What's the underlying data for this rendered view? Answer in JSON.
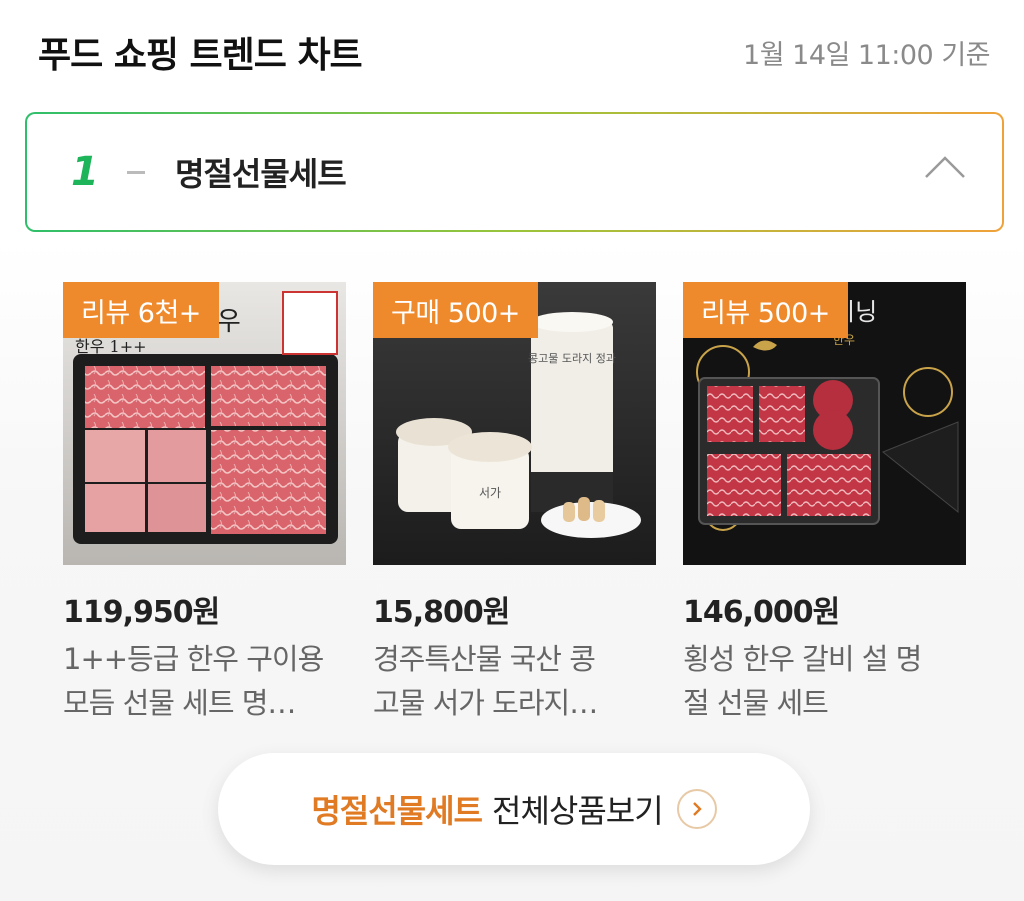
{
  "header": {
    "title": "푸드 쇼핑 트렌드 차트",
    "timestamp": "1월 14일 11:00 기준"
  },
  "ranking": {
    "rank": "1",
    "category": "명절선물세트",
    "icon": "chevron-up-icon"
  },
  "products": [
    {
      "badge": "리뷰 6천+",
      "price": "119,950원",
      "name_line1": "1++등급 한우 구이용",
      "name_line2": "모듬 선물 세트 명…",
      "image_text_1": "한우",
      "image_text_2": "한우 1++"
    },
    {
      "badge": "구매 500+",
      "price": "15,800원",
      "name_line1": "경주특산물 국산 콩",
      "name_line2": "고물 서가 도라지…",
      "image_text_1": "콩고물 도라지 정과",
      "image_text_2": "서가"
    },
    {
      "badge": "리뷰 500+",
      "price": "146,000원",
      "name_line1": "횡성 한우 갈비 설 명",
      "name_line2": "절 선물 세트",
      "image_text_1": "이닝",
      "image_text_2": "한우"
    }
  ],
  "more_button": {
    "category": "명절선물세트",
    "label": "전체상품보기",
    "icon": "chevron-right-icon"
  },
  "colors": {
    "accent_orange": "#ee8a2c",
    "rank_green": "#1db45a"
  }
}
